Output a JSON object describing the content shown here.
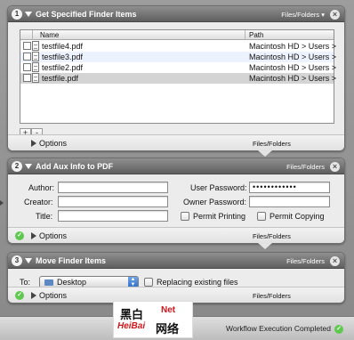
{
  "actions": [
    {
      "number": "1",
      "title": "Get Specified Finder Items",
      "type": "Files/Folders",
      "columns": {
        "name": "Name",
        "path": "Path"
      },
      "files": [
        {
          "name": "testfile4.pdf",
          "path": "Macintosh HD > Users >"
        },
        {
          "name": "testfile3.pdf",
          "path": "Macintosh HD > Users >"
        },
        {
          "name": "testfile2.pdf",
          "path": "Macintosh HD > Users >"
        },
        {
          "name": "testfile.pdf",
          "path": "Macintosh HD > Users >"
        }
      ],
      "add_label": "+",
      "remove_label": "-",
      "options_label": "Options",
      "footer_type": "Files/Folders"
    },
    {
      "number": "2",
      "title": "Add Aux Info to PDF",
      "type": "Files/Folders",
      "author_label": "Author:",
      "creator_label": "Creator:",
      "title_label": "Title:",
      "user_password_label": "User Password:",
      "user_password_value": "••••••••••••",
      "owner_password_label": "Owner Password:",
      "permit_printing_label": "Permit Printing",
      "permit_copying_label": "Permit Copying",
      "options_label": "Options",
      "footer_type": "Files/Folders"
    },
    {
      "number": "3",
      "title": "Move Finder Items",
      "type": "Files/Folders",
      "to_label": "To:",
      "destination": "Desktop",
      "replacing_label": "Replacing existing files",
      "options_label": "Options",
      "footer_type": "Files/Folders"
    }
  ],
  "watermark": {
    "line1": "黑白",
    "line2": "Net",
    "line3": "HeiBai",
    "line4": "网络"
  },
  "status": {
    "text": "Workflow Execution Completed"
  },
  "colors": {
    "header": "#6f6f6f",
    "success": "#5ec94e",
    "selection": "#d4d4d4",
    "accent": "#2f6fcb"
  }
}
